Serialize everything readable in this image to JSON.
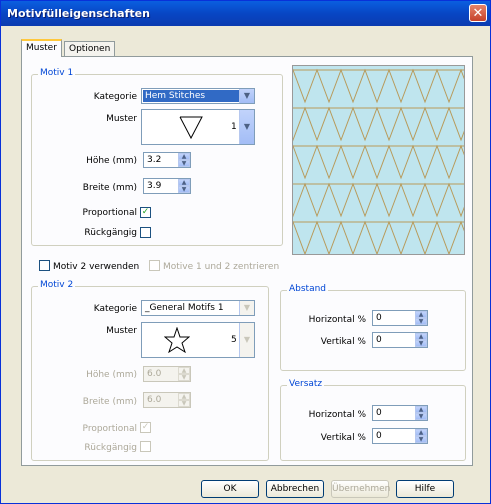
{
  "window": {
    "title": "Motivfülleigenschaften",
    "close_symbol": "✕"
  },
  "tabs": [
    {
      "label": "Muster"
    },
    {
      "label": "Optionen"
    }
  ],
  "motiv1": {
    "group_title": "Motiv 1",
    "kategorie_label": "Kategorie",
    "kategorie_value": "Hem Stitches",
    "muster_label": "Muster",
    "muster_number": "1",
    "hoehe_label": "Höhe (mm)",
    "hoehe_value": "3.2",
    "breite_label": "Breite (mm)",
    "breite_value": "3.9",
    "proportional_label": "Proportional",
    "proportional_checked": true,
    "rueckgaengig_label": "Rückgängig",
    "rueckgaengig_checked": false
  },
  "options": {
    "use_motiv2_label": "Motiv 2 verwenden",
    "center_label": "Motive 1 und 2 zentrieren"
  },
  "motiv2": {
    "group_title": "Motiv 2",
    "kategorie_label": "Kategorie",
    "kategorie_value": "_General Motifs 1",
    "muster_label": "Muster",
    "muster_number": "5",
    "hoehe_label": "Höhe (mm)",
    "hoehe_value": "6.0",
    "breite_label": "Breite (mm)",
    "breite_value": "6.0",
    "proportional_label": "Proportional",
    "rueckgaengig_label": "Rückgängig"
  },
  "abstand": {
    "group_title": "Abstand",
    "horizontal_label": "Horizontal %",
    "horizontal_value": "0",
    "vertikal_label": "Vertikal %",
    "vertikal_value": "0"
  },
  "versatz": {
    "group_title": "Versatz",
    "horizontal_label": "Horizontal %",
    "horizontal_value": "0",
    "vertikal_label": "Vertikal %",
    "vertikal_value": "0"
  },
  "buttons": {
    "ok": "OK",
    "abbrechen": "Abbrechen",
    "uebernehmen": "Übernehmen",
    "hilfe": "Hilfe"
  },
  "colors": {
    "titlebar": "#0a5fe0",
    "group_title": "#0046d5",
    "preview_bg": "#bfe5ee",
    "preview_line": "#b89a5a",
    "check_mark": "#21a121"
  }
}
